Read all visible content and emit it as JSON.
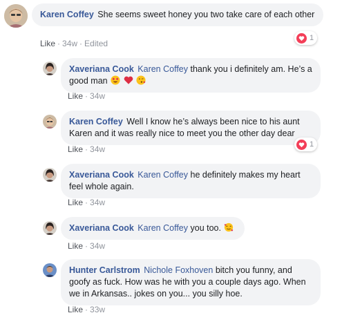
{
  "comments": [
    {
      "author": "Karen Coffey",
      "mention": "",
      "text": "She seems sweet honey you two take care of each other",
      "like_label": "Like",
      "time": "34w",
      "edited": "Edited",
      "reactions": "1",
      "emojis": []
    },
    {
      "author": "Xaveriana Cook",
      "mention": "Karen Coffey",
      "text": "thank you i definitely am. He’s a good man",
      "like_label": "Like",
      "time": "34w",
      "edited": "",
      "reactions": "",
      "emojis": [
        "heart-eyes-emoji",
        "red-heart-emoji",
        "kiss-wink-emoji"
      ]
    },
    {
      "author": "Karen Coffey",
      "mention": "",
      "text": "Well I know he’s always been nice to his aunt Karen and it was really nice to meet you the other day dear",
      "like_label": "Like",
      "time": "34w",
      "edited": "",
      "reactions": "1",
      "emojis": []
    },
    {
      "author": "Xaveriana Cook",
      "mention": "Karen Coffey",
      "text": "he definitely makes my heart feel whole again.",
      "like_label": "Like",
      "time": "34w",
      "edited": "",
      "reactions": "",
      "emojis": []
    },
    {
      "author": "Xaveriana Cook",
      "mention": "Karen Coffey",
      "text": "you too.",
      "like_label": "Like",
      "time": "34w",
      "edited": "",
      "reactions": "",
      "emojis": [
        "smiling-hearts-emoji"
      ]
    },
    {
      "author": "Hunter Carlstrom",
      "mention": "Nichole Foxhoven",
      "text": "bitch you funny, and goofy as fuck. How was he with you a couple days ago. When we in Arkansas.. jokes on you... you silly hoe.",
      "like_label": "Like",
      "time": "33w",
      "edited": "",
      "reactions": "",
      "emojis": []
    }
  ],
  "colors": {
    "link": "#385898",
    "bubble": "#f2f3f5",
    "meta": "#90949c",
    "heart": "#f33e58"
  }
}
